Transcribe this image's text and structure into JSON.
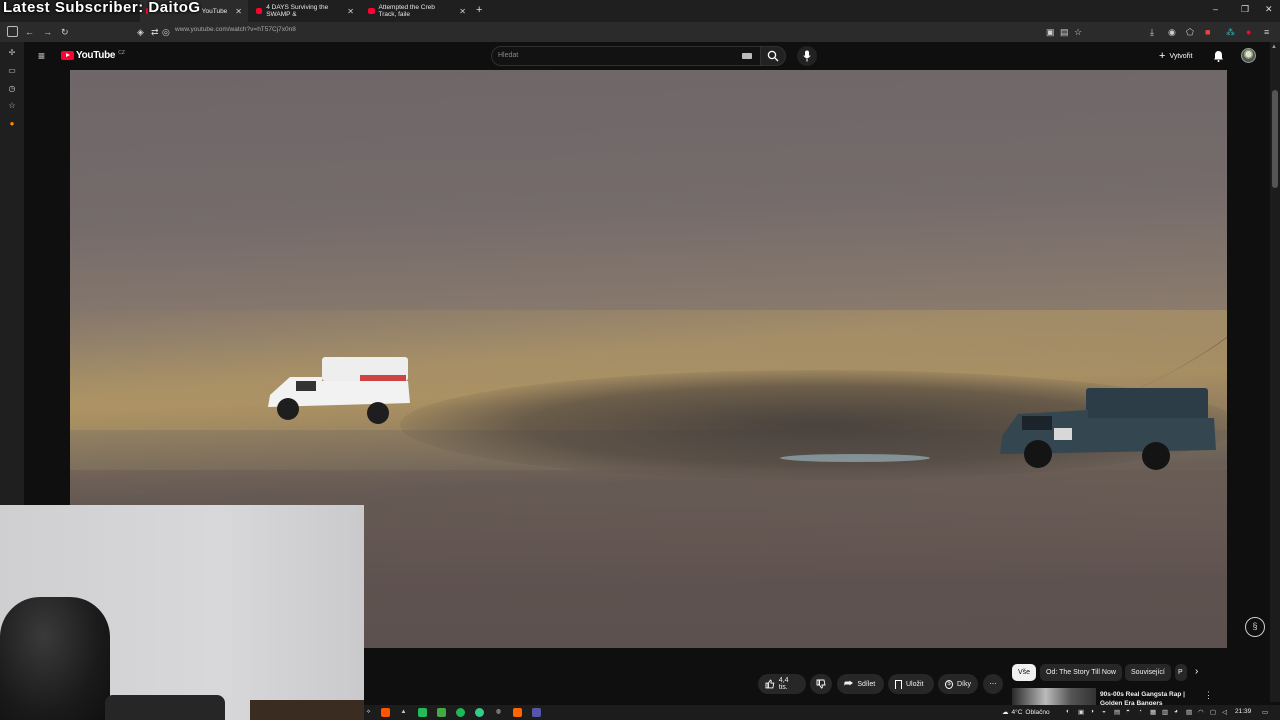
{
  "overlay": {
    "subscriber_text": "Latest Subscriber: DaitoG"
  },
  "browser": {
    "tabs": [
      {
        "label": "YouTube"
      },
      {
        "label": "4 DAYS Surviving the SWAMP &"
      },
      {
        "label": "Attempted the Creb Track, faile"
      }
    ],
    "new_tab": "+",
    "url": "www.youtube.com/watch?v=hT57Cj7x0n8",
    "window_controls": {
      "minimize": "–",
      "maximize": "❐",
      "close": "✕"
    }
  },
  "youtube": {
    "logo_text": "YouTube",
    "region_code": "CZ",
    "search": {
      "placeholder": "Hledat"
    },
    "create_label": "Vytvořit"
  },
  "actions": {
    "like_count": "4,4 tis.",
    "share_label": "Sdílet",
    "save_label": "Uložit",
    "thanks_label": "Díky",
    "more_label": "⋯"
  },
  "chips": [
    {
      "label": "Vše",
      "active": true
    },
    {
      "label": "Od: The Story Till Now",
      "active": false
    },
    {
      "label": "Související",
      "active": false
    },
    {
      "label": "P",
      "active": false
    }
  ],
  "recommendation": {
    "title": "90s-00s Real Gangsta Rap | Golden Era Bangers"
  },
  "taskbar": {
    "weather": {
      "temp": "4°C",
      "condition": "Oblačno"
    },
    "time": "21:39"
  },
  "colors": {
    "youtube_red": "#ff0033",
    "background": "#0f0f0f",
    "chip_bg": "#272727"
  }
}
